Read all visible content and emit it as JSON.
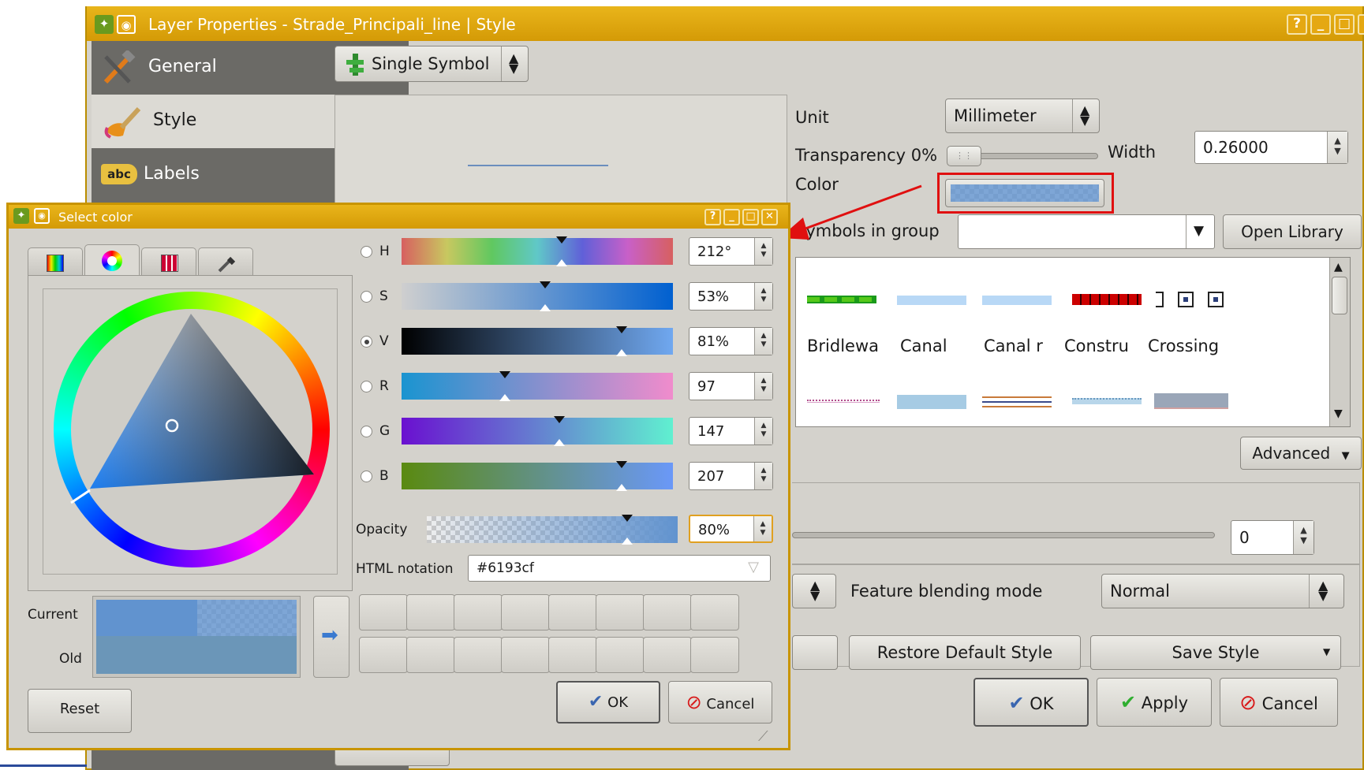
{
  "main_window": {
    "title": "Layer Properties - Strade_Principali_line | Style",
    "title_buttons": [
      "?",
      "_",
      "□",
      "✕"
    ],
    "sidebar": [
      {
        "label": "General",
        "icon": "tools-icon"
      },
      {
        "label": "Style",
        "icon": "paintbrush-icon"
      },
      {
        "label": "Labels",
        "icon": "abc-label-icon"
      }
    ],
    "renderer": "Single Symbol",
    "unit_label": "Unit",
    "unit_value": "Millimeter",
    "transparency_label": "Transparency 0%",
    "width_label": "Width",
    "width_value": "0.26000",
    "color_label": "Color",
    "symbols_in_group_label": "Symbols in group",
    "open_library": "Open Library",
    "symbols": [
      {
        "name": "Bridlewa"
      },
      {
        "name": "Canal"
      },
      {
        "name": "Canal r"
      },
      {
        "name": "Constru"
      },
      {
        "name": "Crossing"
      }
    ],
    "advanced": "Advanced",
    "slider_value": "0",
    "feature_blending_label": "Feature blending mode",
    "feature_blending_value": "Normal",
    "restore_default": "Restore Default Style",
    "save_style": "Save Style",
    "ok": "OK",
    "apply": "Apply",
    "cancel": "Cancel"
  },
  "color_dialog": {
    "title": "Select color",
    "title_buttons": [
      "?",
      "_",
      "□",
      "✕"
    ],
    "channels": [
      {
        "key": "H",
        "value": "212°",
        "marker": 0.59,
        "selected": false
      },
      {
        "key": "S",
        "value": "53%",
        "marker": 0.53,
        "selected": false
      },
      {
        "key": "V",
        "value": "81%",
        "marker": 0.81,
        "selected": true
      },
      {
        "key": "R",
        "value": "97",
        "marker": 0.38,
        "selected": false
      },
      {
        "key": "G",
        "value": "147",
        "marker": 0.58,
        "selected": false
      },
      {
        "key": "B",
        "value": "207",
        "marker": 0.81,
        "selected": false
      }
    ],
    "opacity_label": "Opacity",
    "opacity_value": "80%",
    "opacity_marker": 0.8,
    "html_notation_label": "HTML notation",
    "html_notation_value": "#6193cf",
    "current_label": "Current",
    "old_label": "Old",
    "current_color": "#6193cf",
    "old_color": "#6b96b8",
    "reset": "Reset",
    "ok": "OK",
    "cancel": "Cancel"
  },
  "colors": {
    "title_bar": "#dca30e",
    "highlight_border": "#e01010",
    "arrow": "#e01010"
  }
}
